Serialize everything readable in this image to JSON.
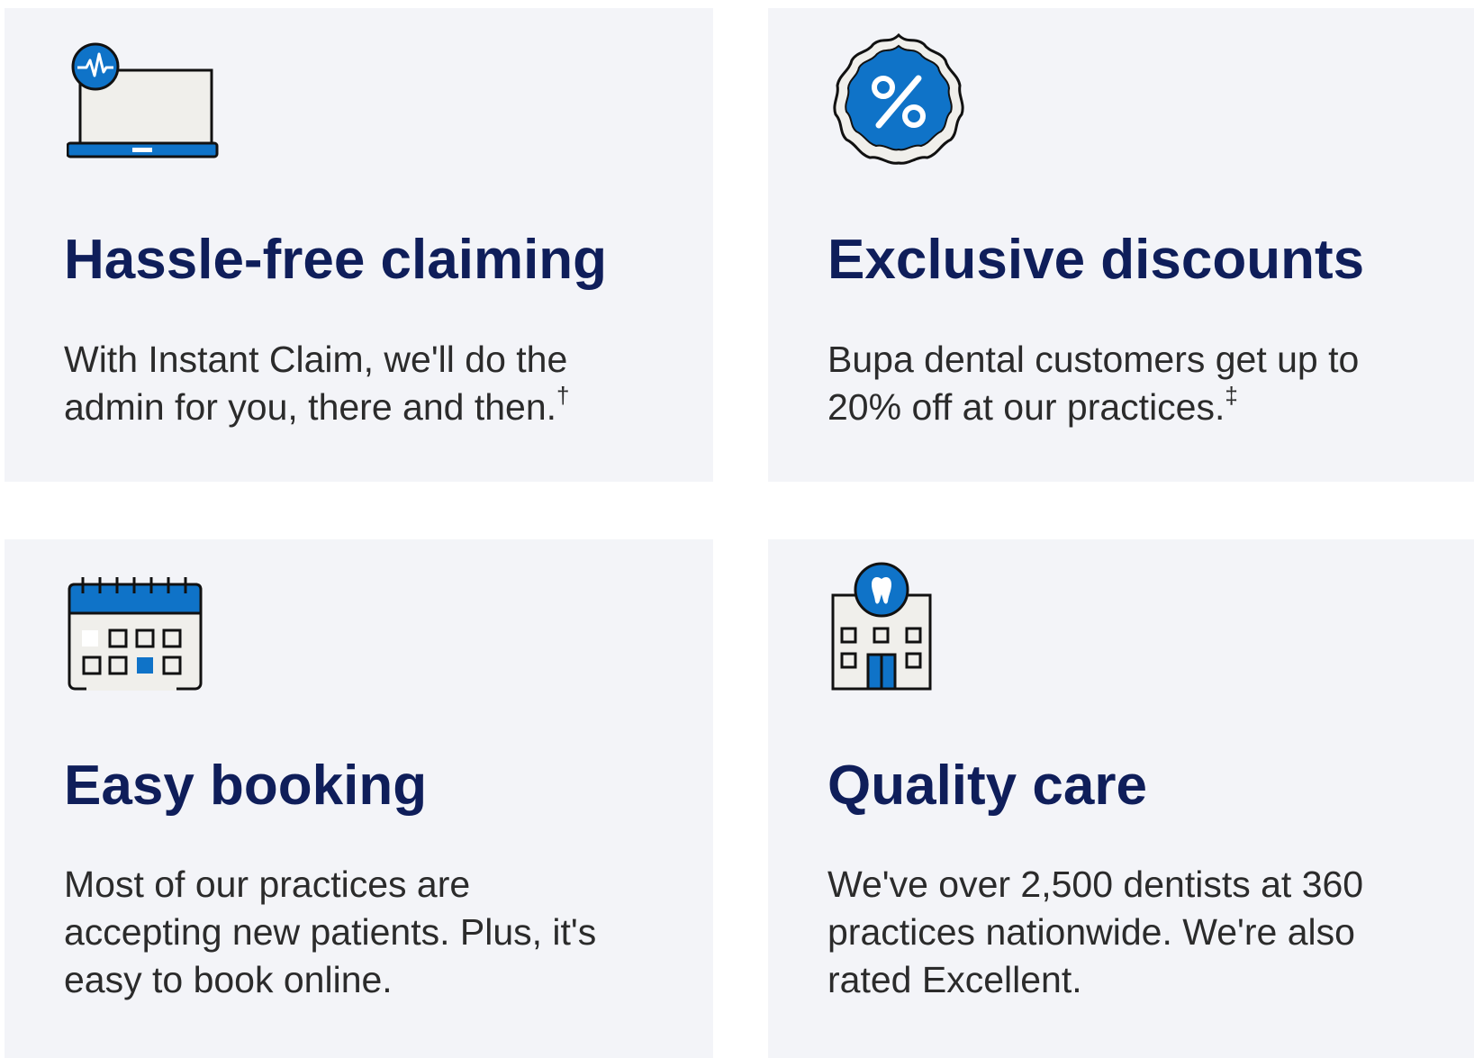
{
  "cards": [
    {
      "icon": "laptop-heartbeat-icon",
      "title": "Hassle-free claiming",
      "lines": [
        "With Instant Claim, we'll do the",
        "admin for you, there and then."
      ],
      "mark": "†"
    },
    {
      "icon": "discount-percent-badge-icon",
      "title": "Exclusive discounts",
      "lines": [
        "Bupa dental customers get up to",
        "20% off at our practices."
      ],
      "mark": "‡"
    },
    {
      "icon": "calendar-icon",
      "title": "Easy booking",
      "lines": [
        "Most of our practices are",
        "accepting new patients. Plus, it's",
        "easy to book online."
      ]
    },
    {
      "icon": "dental-practice-building-icon",
      "title": "Quality care",
      "lines": [
        "We've over 2,500 dentists at 360",
        "practices nationwide. We're also",
        "rated Excellent."
      ]
    }
  ],
  "colors": {
    "card_background": "#f3f4f8",
    "heading": "#0f1e5a",
    "body_text": "#2b2b2b",
    "icon_blue": "#0f73c8",
    "icon_fill": "#f0efeb",
    "icon_outline": "#111111"
  }
}
